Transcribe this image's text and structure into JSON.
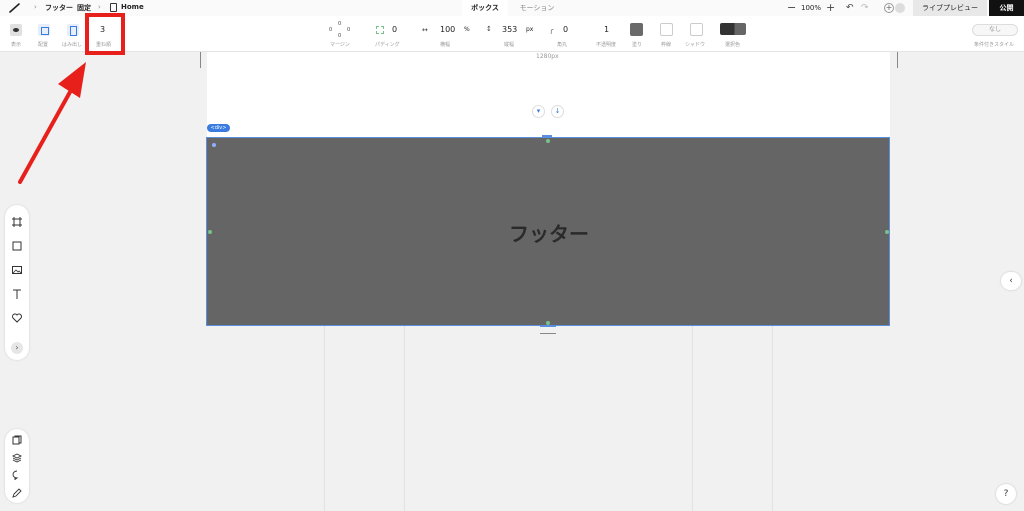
{
  "breadcrumb": {
    "item1": "フッター",
    "item2": "固定",
    "page": "Home"
  },
  "tabs": {
    "box": "ボックス",
    "motion": "モーション"
  },
  "zoom": {
    "minus": "−",
    "value": "100%",
    "plus": "+"
  },
  "header": {
    "live_preview": "ライブプレビュー",
    "publish": "公開"
  },
  "toolbar": {
    "display_label": "表示",
    "layout_label": "配置",
    "overflow_label": "はみ出し",
    "stacking_value": "3",
    "stacking_label": "重ね順",
    "margin_top": "0",
    "margin_left": "0",
    "margin_right": "0",
    "margin_bottom": "0",
    "margin_label": "マージン",
    "padding_value": "0",
    "padding_label": "パディング",
    "width_value": "100",
    "width_unit": "%",
    "width_label": "横幅",
    "height_value": "353",
    "height_unit": "px",
    "height_label": "縦幅",
    "radius_value": "0",
    "radius_label": "角丸",
    "opacity_value": "1",
    "opacity_label": "不透明度",
    "fill_label": "塗り",
    "border_label": "枠線",
    "shadow_label": "シャドウ",
    "selection_label": "選択色",
    "conditional_value": "なし",
    "conditional_label": "条件付きスタイル"
  },
  "canvas": {
    "width_label": "1280px",
    "div_badge": "<div>",
    "footer_text": "フッター"
  },
  "colors": {
    "accent": "#3a7be0",
    "footer_bg": "#656565",
    "highlight": "#e8201c",
    "fill_swatch": "#6a6a6a"
  },
  "icons": [
    "pen-icon",
    "page-icon",
    "undo-icon",
    "redo-icon",
    "eye-icon",
    "layout-icon",
    "overflow-icon",
    "frame-icon",
    "square-icon",
    "image-icon",
    "text-icon",
    "heart-icon",
    "chevron-right-icon",
    "pages-icon",
    "layers-icon",
    "comment-icon",
    "edit-icon",
    "help-icon"
  ],
  "misc": {
    "chevron_more": "›",
    "right_toggle": "‹",
    "help": "?",
    "insert_down": "↓"
  }
}
